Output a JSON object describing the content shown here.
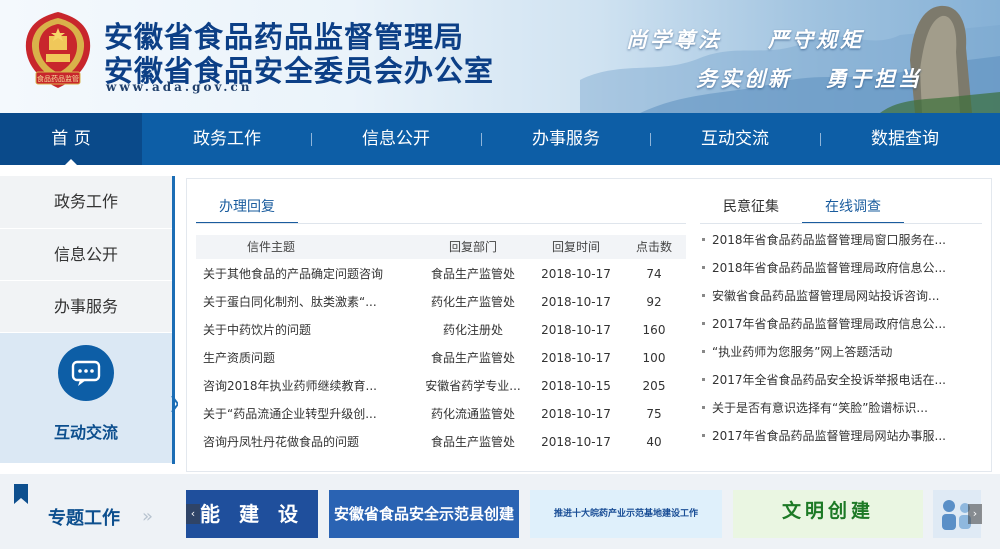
{
  "header": {
    "title_line1": "安徽省食品药品监督管理局",
    "title_line2": "安徽省食品安全委员会办公室",
    "site_url": "www.ada.gov.cn",
    "slogans": [
      "尚学尊法",
      "严守规矩",
      "务实创新",
      "勇于担当"
    ],
    "emblem_text": "食品药品监管"
  },
  "nav": {
    "items": [
      "首 页",
      "政务工作",
      "信息公开",
      "办事服务",
      "互动交流",
      "数据查询"
    ],
    "active_index": 0
  },
  "sidebar": {
    "items": [
      "政务工作",
      "信息公开",
      "办事服务"
    ],
    "active_label": "互动交流",
    "active_icon": "chat-bubble-icon"
  },
  "reply_panel": {
    "tab": "办理回复",
    "columns": [
      "信件主题",
      "回复部门",
      "回复时间",
      "点击数"
    ],
    "rows": [
      {
        "subject": "关于其他食品的产品确定问题咨询",
        "dept": "食品生产监管处",
        "date": "2018-10-17",
        "clicks": "74"
      },
      {
        "subject": "关于蛋白同化制剂、肽类激素“...",
        "dept": "药化生产监管处",
        "date": "2018-10-17",
        "clicks": "92"
      },
      {
        "subject": "关于中药饮片的问题",
        "dept": "药化注册处",
        "date": "2018-10-17",
        "clicks": "160"
      },
      {
        "subject": "生产资质问题",
        "dept": "食品生产监管处",
        "date": "2018-10-17",
        "clicks": "100"
      },
      {
        "subject": "咨询2018年执业药师继续教育...",
        "dept": "安徽省药学专业...",
        "date": "2018-10-15",
        "clicks": "205"
      },
      {
        "subject": "关于“药品流通企业转型升级创...",
        "dept": "药化流通监管处",
        "date": "2018-10-17",
        "clicks": "75"
      },
      {
        "subject": "咨询丹凤牡丹花做食品的问题",
        "dept": "食品生产监管处",
        "date": "2018-10-17",
        "clicks": "40"
      }
    ]
  },
  "survey_panel": {
    "tabs": [
      "民意征集",
      "在线调查"
    ],
    "active_tab": 1,
    "items": [
      "2018年省食品药品监督管理局窗口服务在...",
      "2018年省食品药品监督管理局政府信息公...",
      "安徽省食品药品监督管理局网站投诉咨询...",
      "2017年省食品药品监督管理局政府信息公...",
      "“执业药师为您服务”网上答题活动",
      "2017年全省食品药品安全投诉举报电话在...",
      "关于是否有意识选择有“笑脸”脸谱标识...",
      "2017年省食品药品监督管理局网站办事服..."
    ]
  },
  "topics": {
    "label": "专题工作",
    "chevron": "»",
    "banners": [
      {
        "text": "能 建 设",
        "bg": "#1f4f9c",
        "color": "#ffffff"
      },
      {
        "text": "安徽省食品安全示范县创建",
        "bg": "#2a63b3",
        "color": "#ffffff"
      },
      {
        "text": "推进十大皖药产业示范基地建设工作",
        "bg": "#dff0fb",
        "color": "#1a4e96"
      },
      {
        "text": "文明创建",
        "bg": "#eaf6e2",
        "color": "#1d7a26"
      }
    ],
    "prev_arrow": "‹",
    "next_arrow": "›"
  },
  "colors": {
    "brand_blue": "#0d5ea6",
    "nav_active": "#0a4a8a",
    "title_blue": "#0c3f86",
    "accent_link": "#1a5c9e"
  }
}
